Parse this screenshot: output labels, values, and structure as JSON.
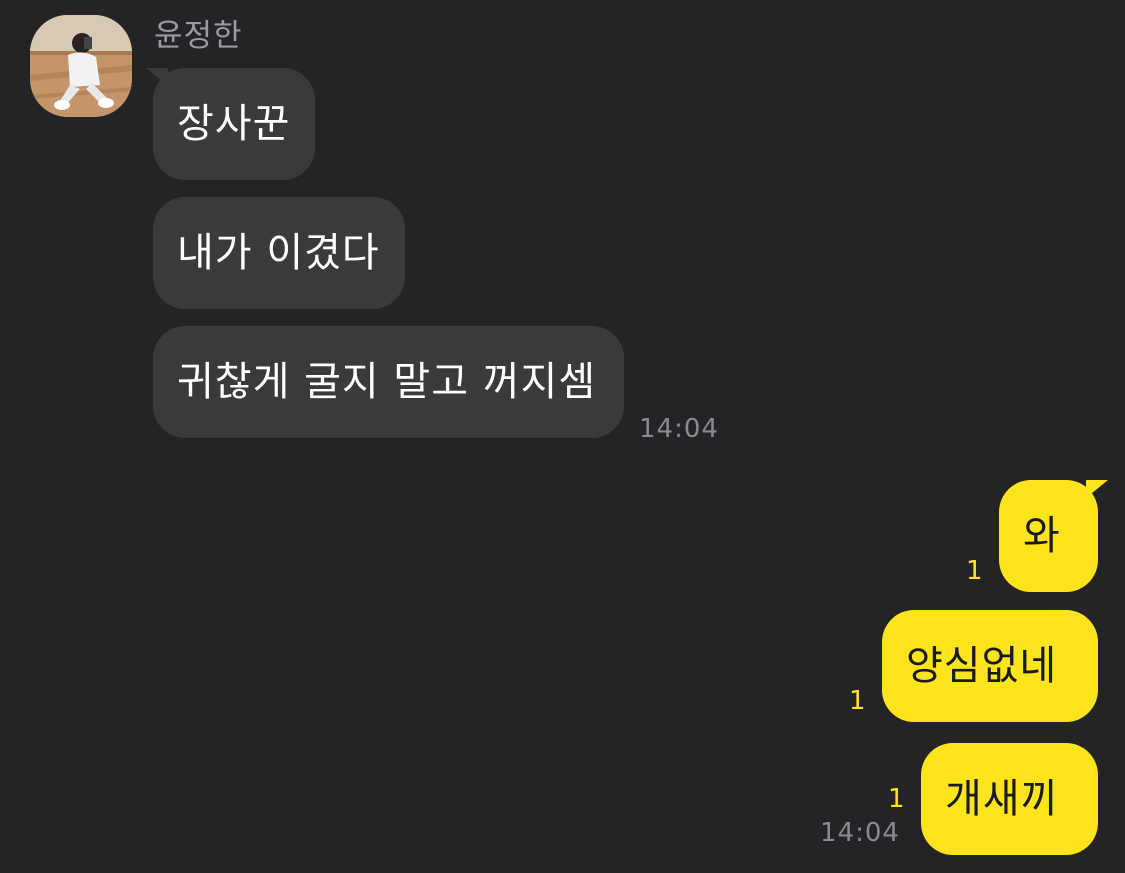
{
  "sender": {
    "name": "윤정한"
  },
  "incoming": [
    {
      "text": "장사꾼"
    },
    {
      "text": "내가 이겼다"
    },
    {
      "text": "귀찮게 굴지 말고 꺼지셈"
    }
  ],
  "incoming_time": "14:04",
  "outgoing": [
    {
      "text": "와",
      "unread": "1"
    },
    {
      "text": "양심없네",
      "unread": "1"
    },
    {
      "text": "개새끼",
      "unread": "1"
    }
  ],
  "outgoing_time": "14:04",
  "colors": {
    "background": "#242426",
    "incoming_bubble": "#3a3a3c",
    "outgoing_bubble": "#fde41b",
    "unread_count": "#fde41b"
  }
}
